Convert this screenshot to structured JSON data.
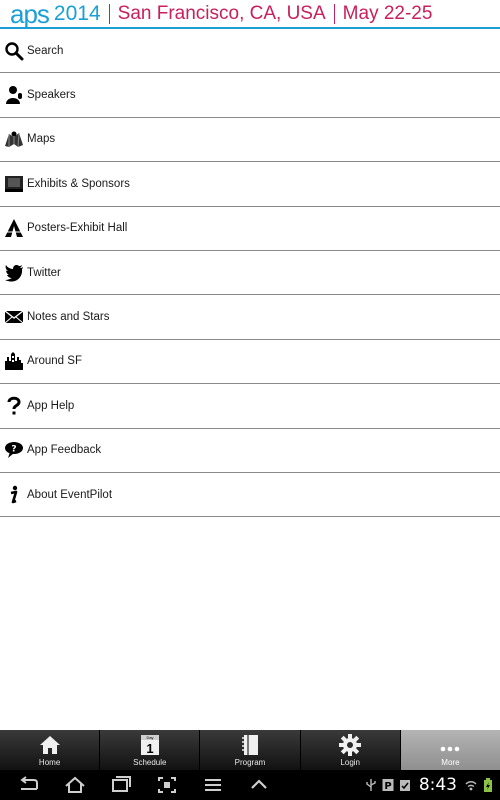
{
  "header": {
    "logo": "aps",
    "year": "2014",
    "location": "San Francisco, CA, USA",
    "dates": "May 22-25",
    "colors": {
      "brand_blue": "#1a9fd6",
      "accent_pink": "#c8205c"
    }
  },
  "menu": {
    "items": [
      {
        "label": "Search",
        "icon": "search-icon"
      },
      {
        "label": "Speakers",
        "icon": "speaker-icon"
      },
      {
        "label": "Maps",
        "icon": "map-icon"
      },
      {
        "label": "Exhibits & Sponsors",
        "icon": "exhibit-booth-icon"
      },
      {
        "label": "Posters-Exhibit Hall",
        "icon": "tent-icon"
      },
      {
        "label": "Twitter",
        "icon": "twitter-bird-icon"
      },
      {
        "label": "Notes and Stars",
        "icon": "envelope-icon"
      },
      {
        "label": "Around SF",
        "icon": "city-skyline-icon"
      },
      {
        "label": "App Help",
        "icon": "question-mark-icon"
      },
      {
        "label": "App Feedback",
        "icon": "feedback-bubble-icon"
      },
      {
        "label": "About EventPilot",
        "icon": "info-icon"
      }
    ]
  },
  "tabbar": {
    "tabs": [
      {
        "label": "Home",
        "icon": "home-icon",
        "active": false
      },
      {
        "label": "Schedule",
        "icon": "calendar-icon",
        "active": false,
        "badge_top": "Day",
        "badge_num": "1"
      },
      {
        "label": "Program",
        "icon": "notebook-icon",
        "active": false
      },
      {
        "label": "Login",
        "icon": "gear-icon",
        "active": false
      },
      {
        "label": "More",
        "icon": "more-dots-icon",
        "active": true
      }
    ]
  },
  "system_bar": {
    "time": "8:43",
    "nav_buttons": [
      "back-icon",
      "home-nav-icon",
      "recent-apps-icon",
      "screenshot-icon",
      "menu-icon",
      "up-chevron-icon"
    ],
    "status_icons": [
      "usb-icon",
      "parking-icon",
      "clipboard-check-icon",
      "wifi-icon",
      "battery-icon"
    ]
  }
}
